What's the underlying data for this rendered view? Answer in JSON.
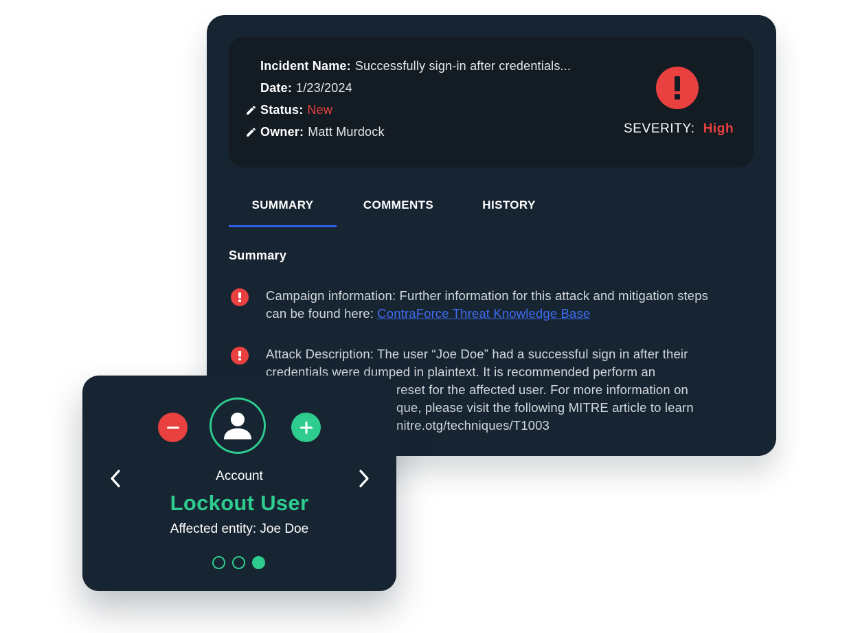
{
  "incident": {
    "name_label": "Incident Name:",
    "name_value": "Successfully sign-in after credentials...",
    "date_label": "Date:",
    "date_value": "1/23/2024",
    "status_label": "Status:",
    "status_value": "New",
    "owner_label": "Owner:",
    "owner_value": "Matt Murdock",
    "severity_label": "SEVERITY:",
    "severity_value": "High"
  },
  "tabs": [
    {
      "label": "SUMMARY",
      "active": true
    },
    {
      "label": "COMMENTS",
      "active": false
    },
    {
      "label": "HISTORY",
      "active": false
    }
  ],
  "summary": {
    "title": "Summary",
    "item1": {
      "line1": "Campaign information: Further information for this attack and mitigation steps",
      "line2_prefix": "can be found here: ",
      "link_text": "ContraForce Threat Knowledge Base"
    },
    "item2": {
      "lines": [
        "Attack Description: The user “Joe Doe” had a successful sign in after their",
        "credentials were dumped in plaintext. It is recommended perform an",
        "reset for the affected user. For more information on",
        "que, please visit the following MITRE article to learn",
        "nitre.otg/techniques/T1003"
      ]
    }
  },
  "action_card": {
    "category": "Account",
    "action": "Lockout User",
    "entity": "Affected entity: Joe Doe",
    "active_page": 3,
    "total_pages": 3
  },
  "colors": {
    "card_bg": "#172532",
    "info_bg": "#131b23",
    "danger": "#e8413f",
    "success": "#2ecc8f",
    "link": "#3f6cf2",
    "tab_indicator": "#2f5fe6"
  },
  "icons": [
    "pencil-icon",
    "exclamation-icon",
    "user-icon",
    "minus-icon",
    "plus-icon",
    "chevron-left-icon",
    "chevron-right-icon"
  ]
}
